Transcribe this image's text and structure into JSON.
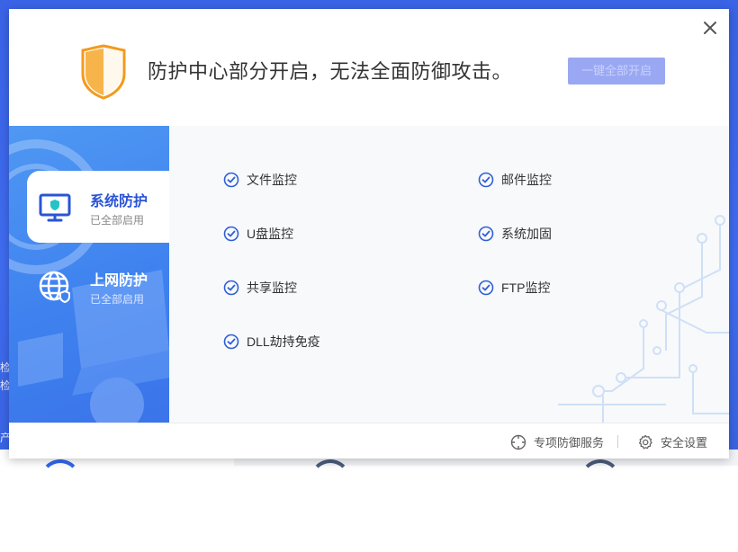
{
  "header": {
    "title": "防护中心部分开启，无法全面防御攻击。",
    "enable_button": "一键全部开启"
  },
  "sidebar": {
    "items": [
      {
        "title": "系统防护",
        "status": "已全部启用",
        "icon": "monitor-shield-icon",
        "active": true
      },
      {
        "title": "上网防护",
        "status": "已全部启用",
        "icon": "globe-shield-icon",
        "active": false
      }
    ]
  },
  "monitors": [
    {
      "label": "文件监控"
    },
    {
      "label": "邮件监控"
    },
    {
      "label": "U盘监控"
    },
    {
      "label": "系统加固"
    },
    {
      "label": "共享监控"
    },
    {
      "label": "FTP监控"
    },
    {
      "label": "DLL劫持免疫"
    }
  ],
  "footer": {
    "service_link": "专项防御服务",
    "settings_link": "安全设置"
  },
  "background": {
    "left_text_1": "检",
    "left_text_2": "检",
    "left_text_3": "产"
  },
  "colors": {
    "accent": "#2a54d6",
    "check": "#2f5fd8",
    "side_gradient_start": "#4f98f3",
    "side_gradient_end": "#3a74ea",
    "shield_orange": "#f39a1d"
  }
}
